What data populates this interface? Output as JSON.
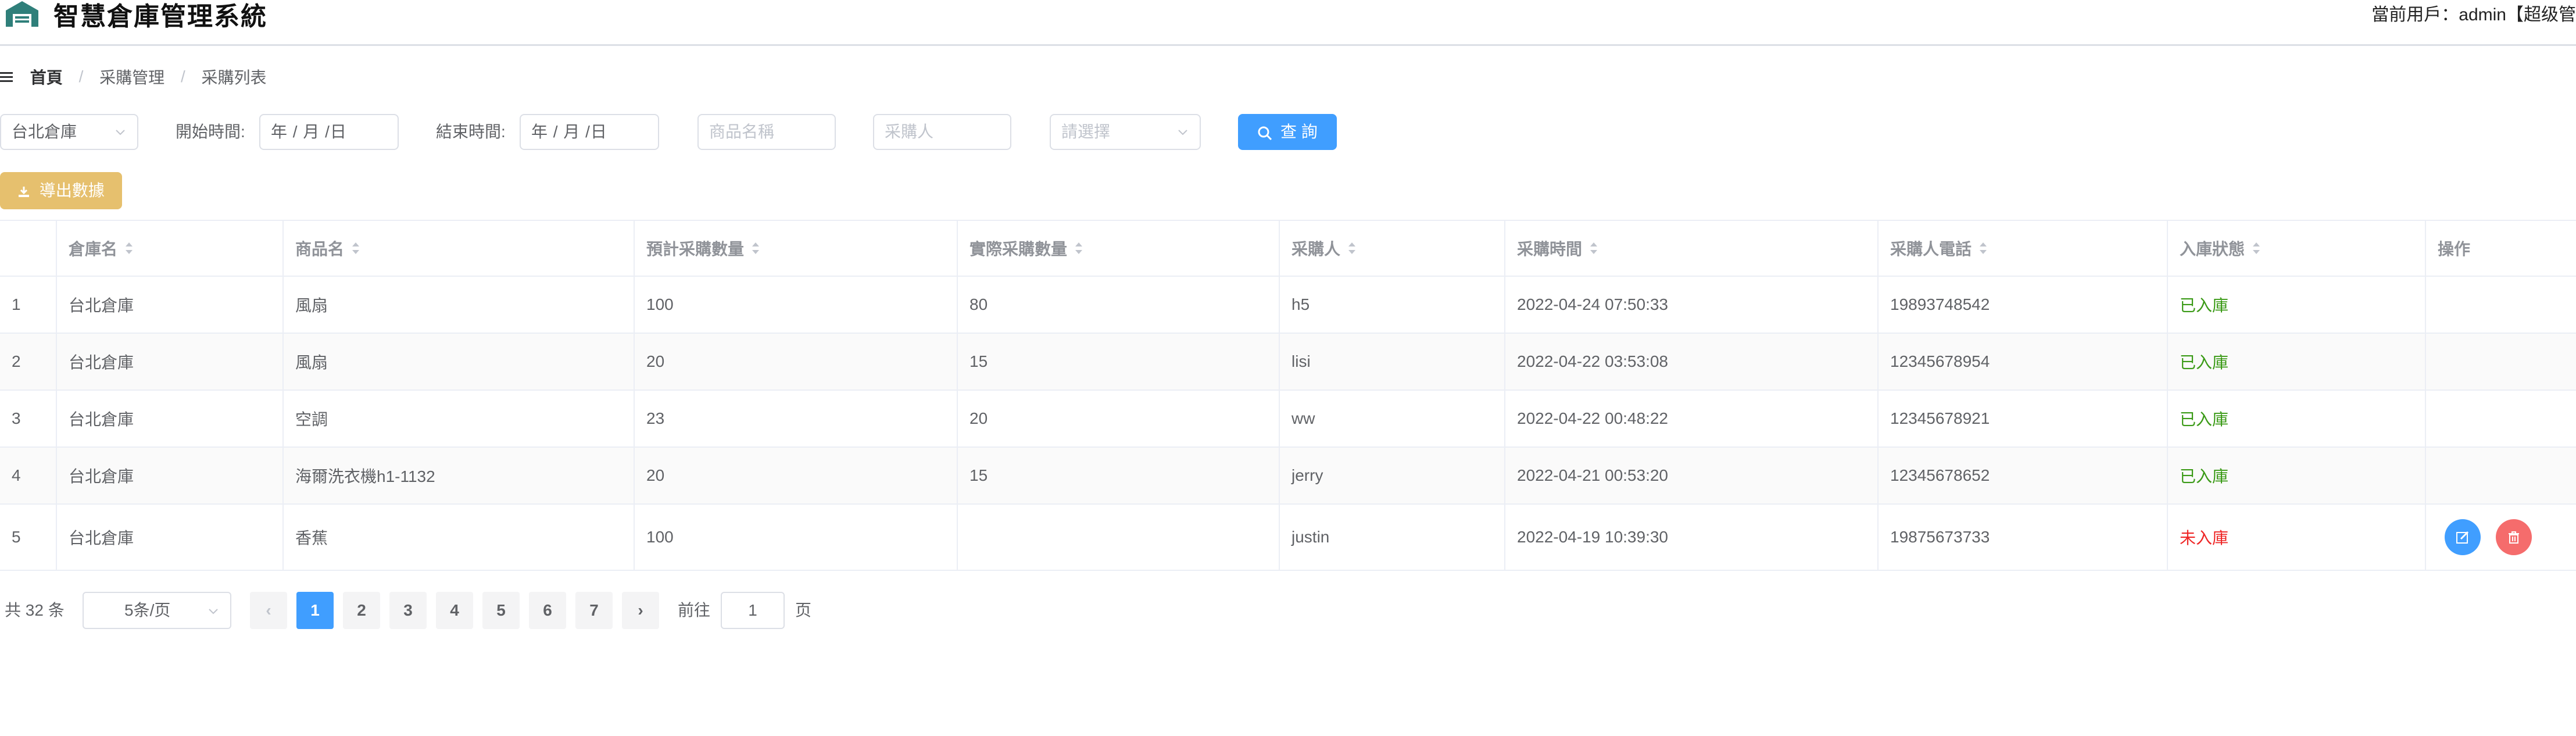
{
  "header": {
    "title": "智慧倉庫管理系統",
    "user": "當前用戶：admin【超级管"
  },
  "breadcrumb": {
    "home": "首頁",
    "parent": "采購管理",
    "current": "采購列表"
  },
  "filters": {
    "warehouse": "台北倉庫",
    "start_label": "開始時間:",
    "start_value": "年 / 月 /日",
    "end_label": "結束時間:",
    "end_value": "年 / 月 /日",
    "product_placeholder": "商品名稱",
    "buyer_placeholder": "采購人",
    "status_placeholder": "請選擇",
    "search_label": "查 詢"
  },
  "export_label": "導出數據",
  "table": {
    "columns": [
      "",
      "倉庫名",
      "商品名",
      "預計采購數量",
      "實際采購數量",
      "采購人",
      "采購時間",
      "采購人電話",
      "入庫狀態",
      "操作"
    ],
    "rows": [
      {
        "index": "1",
        "warehouse": "台北倉庫",
        "product": "風扇",
        "planned": "100",
        "actual": "80",
        "buyer": "h5",
        "time": "2022-04-24 07:50:33",
        "phone": "19893748542",
        "status": "已入庫"
      },
      {
        "index": "2",
        "warehouse": "台北倉庫",
        "product": "風扇",
        "planned": "20",
        "actual": "15",
        "buyer": "lisi",
        "time": "2022-04-22 03:53:08",
        "phone": "12345678954",
        "status": "已入庫"
      },
      {
        "index": "3",
        "warehouse": "台北倉庫",
        "product": "空調",
        "planned": "23",
        "actual": "20",
        "buyer": "ww",
        "time": "2022-04-22 00:48:22",
        "phone": "12345678921",
        "status": "已入庫"
      },
      {
        "index": "4",
        "warehouse": "台北倉庫",
        "product": "海爾洗衣機h1-1132",
        "planned": "20",
        "actual": "15",
        "buyer": "jerry",
        "time": "2022-04-21 00:53:20",
        "phone": "12345678652",
        "status": "已入庫"
      },
      {
        "index": "5",
        "warehouse": "台北倉庫",
        "product": "香蕉",
        "planned": "100",
        "actual": "",
        "buyer": "justin",
        "time": "2022-04-19 10:39:30",
        "phone": "19875673733",
        "status": "未入庫"
      }
    ]
  },
  "pagination": {
    "total": "共 32 条",
    "page_size": "5条/页",
    "pages": [
      "1",
      "2",
      "3",
      "4",
      "5",
      "6",
      "7"
    ],
    "current_page": "1",
    "goto_label": "前往",
    "goto_value": "1",
    "goto_suffix": "页",
    "prev_label": "‹",
    "next_label": "›"
  },
  "colors": {
    "primary": "#409eff",
    "export": "#e6c06e",
    "success": "#3a9a16",
    "danger": "#ee2626",
    "delete": "#f56c6c"
  }
}
